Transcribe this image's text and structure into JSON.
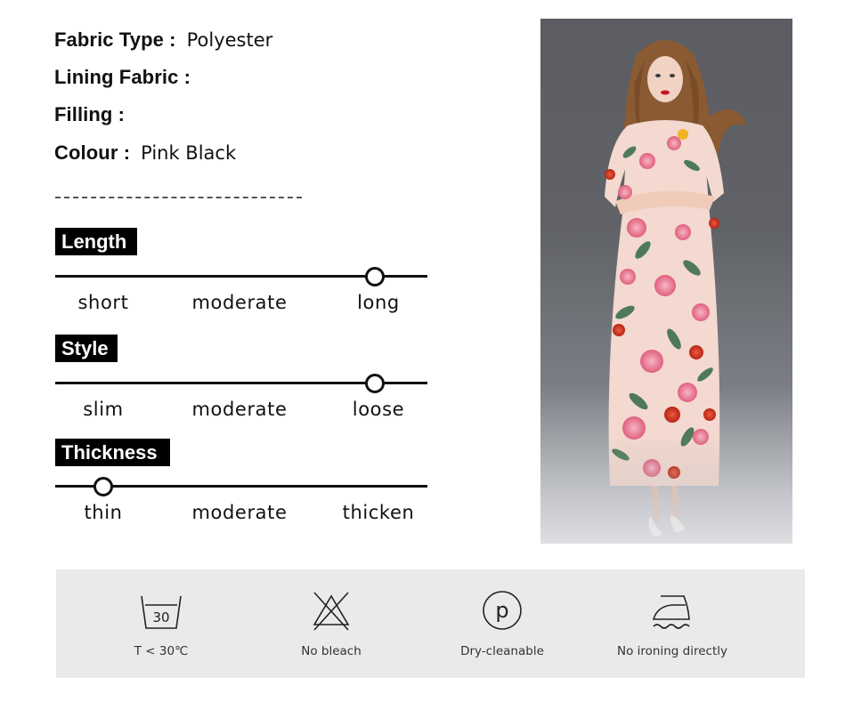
{
  "specs": [
    {
      "label": "Fabric Type :",
      "value": "Polyester"
    },
    {
      "label": "Lining Fabric :",
      "value": ""
    },
    {
      "label": "Filling :",
      "value": ""
    },
    {
      "label": "Colour :",
      "value": "Pink Black"
    }
  ],
  "attributes": [
    {
      "name": "Length",
      "options": [
        "short",
        "moderate",
        "long"
      ],
      "selected": "long",
      "level": 0.86
    },
    {
      "name": "Style",
      "options": [
        "slim",
        "moderate",
        "loose"
      ],
      "selected": "loose",
      "level": 0.86
    },
    {
      "name": "Thickness",
      "options": [
        "thin",
        "moderate",
        "thicken"
      ],
      "selected": "thin",
      "level": 0.13
    }
  ],
  "photo": {
    "description": "Model wearing long-sleeve floral print maxi dress",
    "background_color": "#5e6065",
    "dress_base_color": "#f3d9cf",
    "rose_color": "#e8799a",
    "red_rose_color": "#d0331f",
    "leaf_color": "#4f7a5a",
    "hair_color": "#8a5a33"
  },
  "care": [
    {
      "icon": "wash-30-icon",
      "number": "30",
      "label": "T < 30℃"
    },
    {
      "icon": "no-bleach-icon",
      "label": "No bleach"
    },
    {
      "icon": "dry-clean-p-icon",
      "letter": "p",
      "label": "Dry-cleanable"
    },
    {
      "icon": "iron-steam-icon",
      "label": "No ironing directly"
    }
  ],
  "colors": {
    "text": "#111111",
    "badge_bg": "#000000",
    "badge_text": "#ffffff",
    "care_panel_bg": "#ebeaea",
    "care_text": "#333333"
  }
}
